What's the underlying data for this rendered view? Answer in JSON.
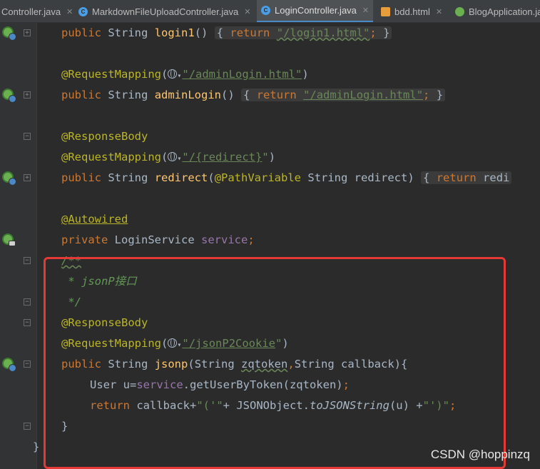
{
  "tabs": [
    {
      "label": "Controller.java",
      "icon": "none",
      "active": false
    },
    {
      "label": "MarkdownFileUploadController.java",
      "icon": "class",
      "active": false
    },
    {
      "label": "LoginController.java",
      "icon": "class",
      "active": true
    },
    {
      "label": "bdd.html",
      "icon": "html",
      "active": false
    },
    {
      "label": "BlogApplication.ja",
      "icon": "boot",
      "active": false
    }
  ],
  "code": {
    "l1": {
      "kw1": "public",
      "type": "String",
      "fn": "login1",
      "paren": "()",
      "ret": "return",
      "str": "\"/login1.html\"",
      "end": ";",
      "brace_open": "{",
      "brace_close": "}"
    },
    "l3": {
      "ann": "@RequestMapping",
      "open": "(",
      "str": "\"/adminLogin.html\"",
      "close": ")"
    },
    "l4": {
      "kw1": "public",
      "type": "String",
      "fn": "adminLogin",
      "paren": "()",
      "ret": "return",
      "str": "\"/adminLogin.html\"",
      "end": ";",
      "brace_open": "{",
      "brace_close": "}"
    },
    "l6": {
      "ann": "@ResponseBody"
    },
    "l7": {
      "ann": "@RequestMapping",
      "open": "(",
      "str_pre": "\"/",
      "str_mid": "{redirect}",
      "str_post": "\"",
      "close": ")"
    },
    "l8": {
      "kw1": "public",
      "type": "String",
      "fn": "redirect",
      "open": "(",
      "ann": "@PathVariable",
      "param": "String redirect)",
      "ret": "return",
      "rest": "redi",
      "brace_open": "{"
    },
    "l10": {
      "ann": "@Autowired"
    },
    "l11": {
      "kw1": "private",
      "type": "LoginService",
      "field": "service",
      "end": ";"
    },
    "l12": {
      "cmt": "/**"
    },
    "l13": {
      "cmt": " * jsonP接口"
    },
    "l14": {
      "cmt": " */"
    },
    "l15": {
      "ann": "@ResponseBody"
    },
    "l16": {
      "ann": "@RequestMapping",
      "open": "(",
      "str_pre": "\"/",
      "str_mid": "jsonP2Cookie",
      "str_post": "\"",
      "close": ")"
    },
    "l17": {
      "kw1": "public",
      "type": "String",
      "fn": "jsonp",
      "open": "(String ",
      "p1": "zqtoken",
      "comma": ",",
      "p2": "String callback){"
    },
    "l18": {
      "pre": "User u=",
      "field": "service",
      "call": ".getUserByToken(zqtoken)",
      "end": ";"
    },
    "l19": {
      "ret": "return",
      "pre": " callback+",
      "s1": "\"('\"",
      "mid1": "+ JSONObject.",
      "itl": "toJSONString",
      "mid2": "(u) +",
      "s2": "\"')\"",
      "end": ";"
    },
    "l20": {
      "brace": "}"
    },
    "l21": {
      "brace": "}"
    }
  },
  "watermark": "CSDN @hoppinzq",
  "colors": {
    "highlight": "#e53935",
    "keyword": "#cc7832",
    "string": "#6a8759",
    "annotation": "#bbb529",
    "method": "#ffc66d",
    "field": "#9876aa"
  }
}
